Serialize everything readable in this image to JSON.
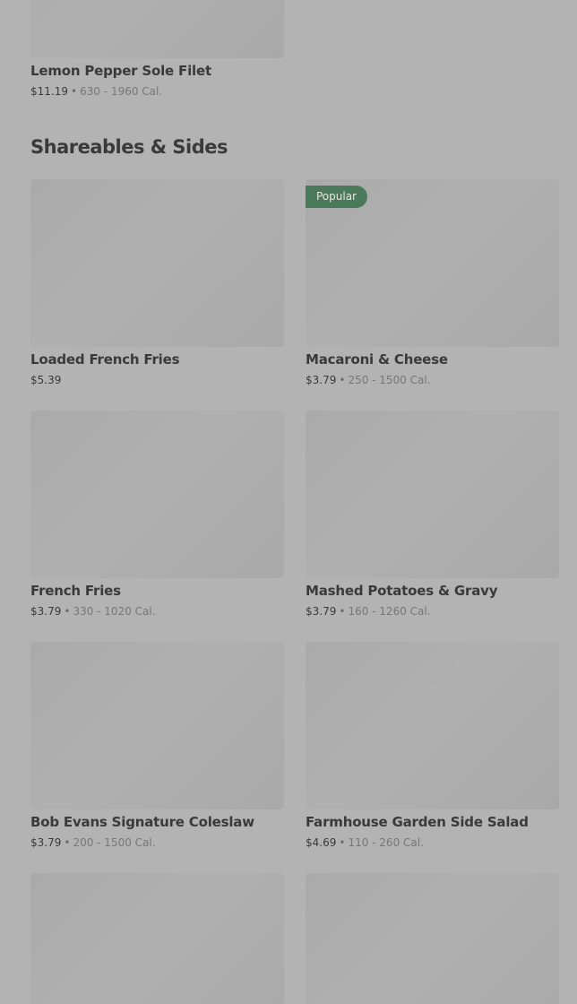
{
  "top_item": {
    "name": "Lemon Pepper Sole Filet",
    "price": "$11.19",
    "calories": "630 - 1960 Cal."
  },
  "section": {
    "title": "Shareables & Sides"
  },
  "items": [
    {
      "name": "Loaded French Fries",
      "price": "$5.39",
      "calories": ""
    },
    {
      "name": "Macaroni & Cheese",
      "price": "$3.79",
      "calories": "250 - 1500 Cal.",
      "badge": "Popular"
    },
    {
      "name": "French Fries",
      "price": "$3.79",
      "calories": "330 - 1020 Cal."
    },
    {
      "name": "Mashed Potatoes & Gravy",
      "price": "$3.79",
      "calories": "160 - 1260 Cal."
    },
    {
      "name": "Bob Evans Signature Coleslaw",
      "price": "$3.79",
      "calories": "200 - 1500 Cal."
    },
    {
      "name": "Farmhouse Garden Side Salad",
      "price": "$4.69",
      "calories": "110 - 260 Cal."
    }
  ],
  "colors": {
    "background": "#b3b3b3",
    "badge": "#4b7a5a"
  }
}
